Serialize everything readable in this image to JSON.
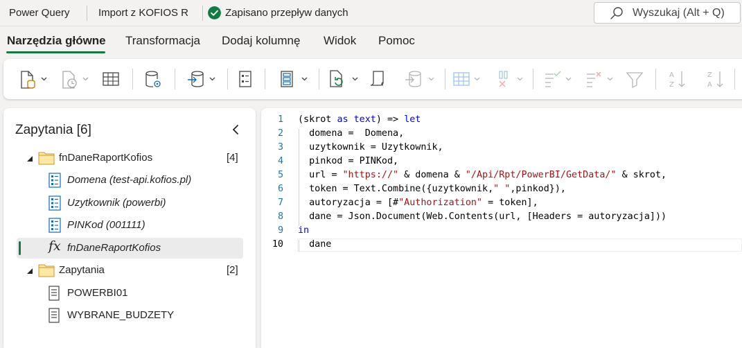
{
  "titlebar": {
    "app_name": "Power Query",
    "document_name": "Import z KOFIOS R",
    "status_text": "Zapisano przepływ danych",
    "search_placeholder": "Wyszukaj (Alt + Q)"
  },
  "tabs": [
    {
      "label": "Narzędzia główne",
      "active": true
    },
    {
      "label": "Transformacja",
      "active": false
    },
    {
      "label": "Dodaj kolumnę",
      "active": false
    },
    {
      "label": "Widok",
      "active": false
    },
    {
      "label": "Pomoc",
      "active": false
    }
  ],
  "ribbon": {
    "buttons": [
      {
        "icon": "new-source-icon",
        "dropdown": true
      },
      {
        "icon": "recent-sources-icon",
        "dropdown": true
      },
      {
        "icon": "enter-data-icon",
        "dropdown": false
      },
      {
        "icon": "data-source-options-icon",
        "dropdown": false
      },
      {
        "icon": "get-data-icon",
        "dropdown": true
      },
      {
        "icon": "manage-parameters-icon",
        "dropdown": false
      },
      {
        "icon": "manage-columns-icon",
        "dropdown": true
      },
      {
        "icon": "refresh-icon",
        "dropdown": true
      },
      {
        "icon": "advanced-editor-icon",
        "dropdown": false
      },
      {
        "icon": "map-to-entity-icon",
        "dropdown": true
      },
      {
        "icon": "choose-columns-icon",
        "dropdown": true
      },
      {
        "icon": "remove-columns-icon",
        "dropdown": true
      },
      {
        "icon": "keep-rows-icon",
        "dropdown": true
      },
      {
        "icon": "remove-rows-icon",
        "dropdown": true
      },
      {
        "icon": "filter-icon",
        "dropdown": false
      },
      {
        "icon": "sort-ascending-icon",
        "dropdown": false
      },
      {
        "icon": "sort-descending-icon",
        "dropdown": false
      }
    ]
  },
  "queries_panel": {
    "title": "Zapytania [6]",
    "groups": [
      {
        "name": "fnDaneRaportKofios",
        "count": "[4]",
        "items": [
          {
            "label": "Domena (test-api.kofios.pl)",
            "type": "parameter"
          },
          {
            "label": "Uzytkownik (powerbi)",
            "type": "parameter"
          },
          {
            "label": "PINKod (001111)",
            "type": "parameter"
          },
          {
            "label": "fnDaneRaportKofios",
            "type": "function",
            "selected": true
          }
        ]
      },
      {
        "name": "Zapytania",
        "count": "[2]",
        "items": [
          {
            "label": "POWERBI01",
            "type": "query"
          },
          {
            "label": "WYBRANE_BUDZETY",
            "type": "query"
          }
        ]
      }
    ]
  },
  "editor": {
    "line_numbers": [
      "1",
      "2",
      "3",
      "4",
      "5",
      "6",
      "7",
      "8",
      "9",
      "10"
    ],
    "lines": [
      [
        {
          "t": "(skrot ",
          "c": ""
        },
        {
          "t": "as",
          "c": "kw"
        },
        {
          "t": " ",
          "c": ""
        },
        {
          "t": "text",
          "c": "kw"
        },
        {
          "t": ") => ",
          "c": ""
        },
        {
          "t": "let",
          "c": "kw"
        }
      ],
      [
        {
          "t": "  domena =  Domena,",
          "c": ""
        }
      ],
      [
        {
          "t": "  uzytkownik = Uzytkownik,",
          "c": ""
        }
      ],
      [
        {
          "t": "  pinkod = PINKod,",
          "c": ""
        }
      ],
      [
        {
          "t": "  url = ",
          "c": ""
        },
        {
          "t": "\"https://\"",
          "c": "str"
        },
        {
          "t": " & domena & ",
          "c": ""
        },
        {
          "t": "\"/Api/Rpt/PowerBI/GetData/\"",
          "c": "str"
        },
        {
          "t": " & skrot,",
          "c": ""
        }
      ],
      [
        {
          "t": "  token = Text.Combine({uzytkownik,",
          "c": ""
        },
        {
          "t": "\" \"",
          "c": "str"
        },
        {
          "t": ",pinkod}),",
          "c": ""
        }
      ],
      [
        {
          "t": "  autoryzacja = [#",
          "c": ""
        },
        {
          "t": "\"Authorization\"",
          "c": "str"
        },
        {
          "t": " = token],",
          "c": ""
        }
      ],
      [
        {
          "t": "  dane = Json.Document(Web.Contents(url, [Headers = autoryzacja]))",
          "c": ""
        }
      ],
      [
        {
          "t": "in",
          "c": "kw"
        }
      ],
      [
        {
          "t": "  dane",
          "c": ""
        }
      ]
    ]
  },
  "colors": {
    "accent": "#107c41",
    "keyword": "#0000ff",
    "string": "#a31515",
    "line_number": "#237893"
  }
}
